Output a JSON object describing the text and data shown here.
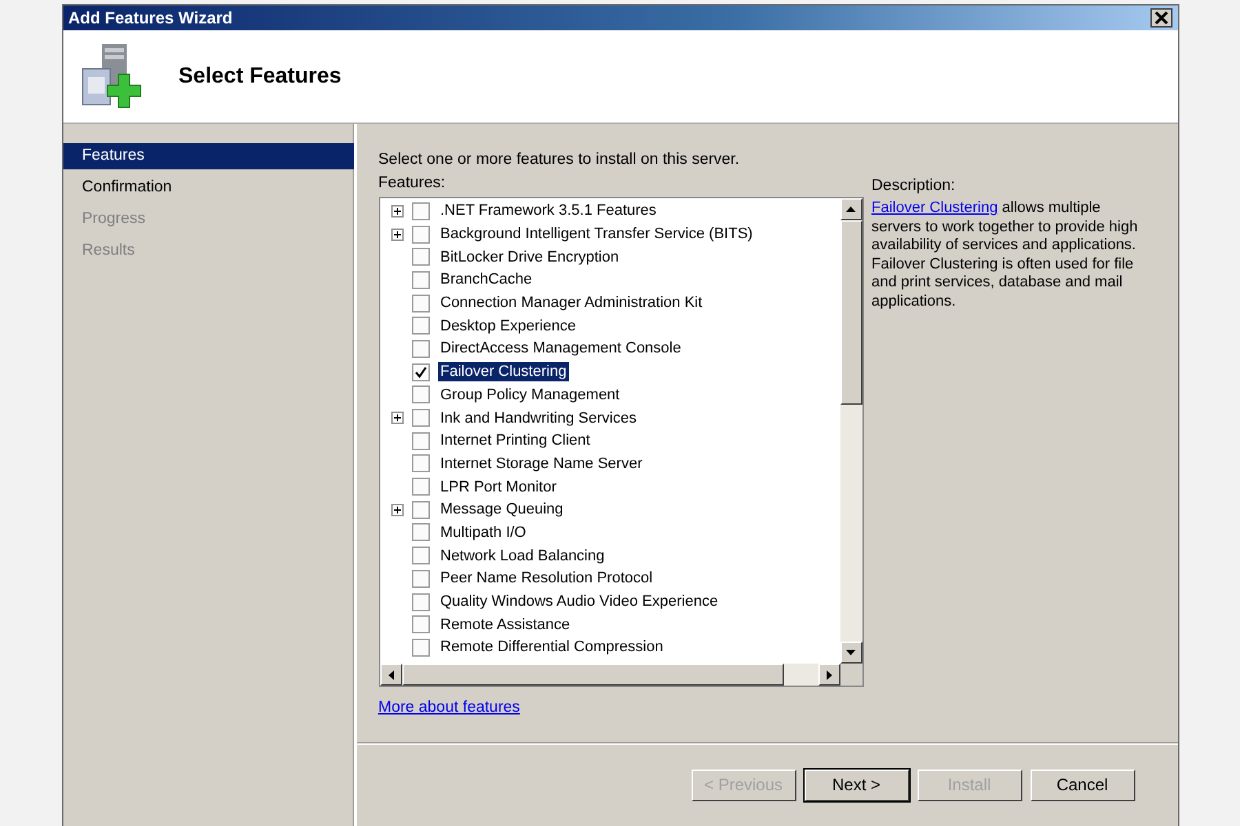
{
  "window": {
    "title": "Add Features Wizard",
    "heading": "Select Features"
  },
  "sidebar": {
    "items": [
      {
        "label": "Features",
        "selected": true,
        "disabled": false
      },
      {
        "label": "Confirmation",
        "selected": false,
        "disabled": false
      },
      {
        "label": "Progress",
        "selected": false,
        "disabled": true
      },
      {
        "label": "Results",
        "selected": false,
        "disabled": true
      }
    ]
  },
  "instruction": "Select one or more features to install on this server.",
  "features_label": "Features:",
  "features": [
    {
      "label": ".NET Framework 3.5.1 Features",
      "expandable": true,
      "checked": false,
      "selected": false
    },
    {
      "label": "Background Intelligent Transfer Service (BITS)",
      "expandable": true,
      "checked": false,
      "selected": false
    },
    {
      "label": "BitLocker Drive Encryption",
      "expandable": false,
      "checked": false,
      "selected": false
    },
    {
      "label": "BranchCache",
      "expandable": false,
      "checked": false,
      "selected": false
    },
    {
      "label": "Connection Manager Administration Kit",
      "expandable": false,
      "checked": false,
      "selected": false
    },
    {
      "label": "Desktop Experience",
      "expandable": false,
      "checked": false,
      "selected": false
    },
    {
      "label": "DirectAccess Management Console",
      "expandable": false,
      "checked": false,
      "selected": false
    },
    {
      "label": "Failover Clustering",
      "expandable": false,
      "checked": true,
      "selected": true
    },
    {
      "label": "Group Policy Management",
      "expandable": false,
      "checked": false,
      "selected": false
    },
    {
      "label": "Ink and Handwriting Services",
      "expandable": true,
      "checked": false,
      "selected": false
    },
    {
      "label": "Internet Printing Client",
      "expandable": false,
      "checked": false,
      "selected": false
    },
    {
      "label": "Internet Storage Name Server",
      "expandable": false,
      "checked": false,
      "selected": false
    },
    {
      "label": "LPR Port Monitor",
      "expandable": false,
      "checked": false,
      "selected": false
    },
    {
      "label": "Message Queuing",
      "expandable": true,
      "checked": false,
      "selected": false
    },
    {
      "label": "Multipath I/O",
      "expandable": false,
      "checked": false,
      "selected": false
    },
    {
      "label": "Network Load Balancing",
      "expandable": false,
      "checked": false,
      "selected": false
    },
    {
      "label": "Peer Name Resolution Protocol",
      "expandable": false,
      "checked": false,
      "selected": false
    },
    {
      "label": "Quality Windows Audio Video Experience",
      "expandable": false,
      "checked": false,
      "selected": false
    },
    {
      "label": "Remote Assistance",
      "expandable": false,
      "checked": false,
      "selected": false
    },
    {
      "label": "Remote Differential Compression",
      "expandable": false,
      "checked": false,
      "selected": false
    }
  ],
  "description": {
    "label": "Description:",
    "link": "Failover Clustering",
    "text": "allows multiple servers to work together to provide high availability of services and applications. Failover Clustering is often used for file and print services, database and mail applications."
  },
  "more_link": "More about features",
  "buttons": [
    {
      "label": "< Previous",
      "disabled": true,
      "default": false
    },
    {
      "label": "Next >",
      "disabled": false,
      "default": true
    },
    {
      "label": "Install",
      "disabled": true,
      "default": false
    },
    {
      "label": "Cancel",
      "disabled": false,
      "default": false
    }
  ]
}
